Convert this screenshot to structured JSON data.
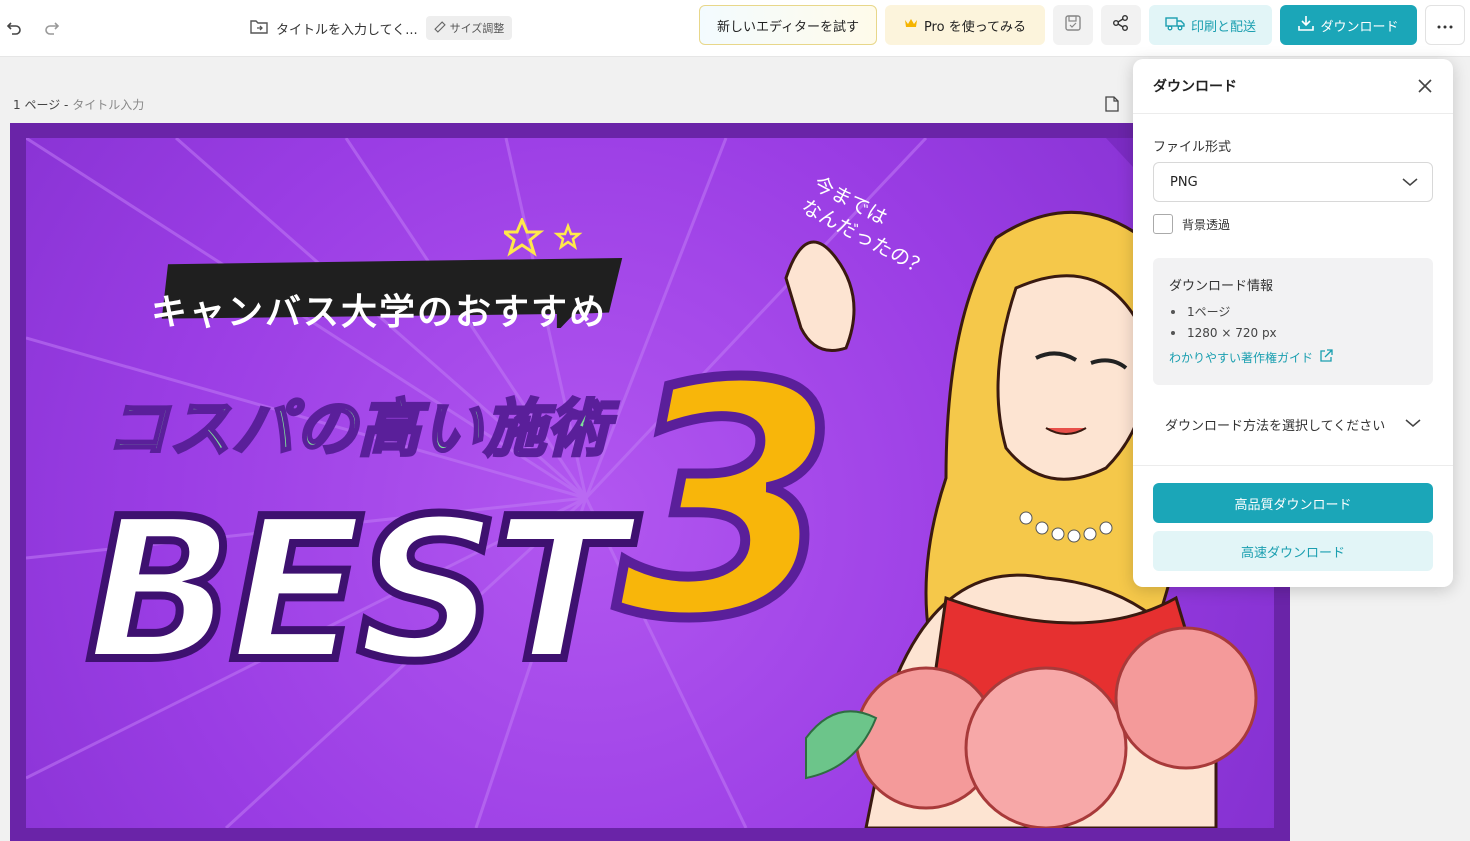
{
  "toolbar": {
    "title": "タイトルを入力してく...",
    "resize_label": "サイズ調整",
    "new_editor_label": "新しいエディターを試す",
    "pro_label": "Pro を使ってみる",
    "print_label": "印刷と配送",
    "download_label": "ダウンロード"
  },
  "page": {
    "label_number": "1 ページ",
    "label_title": "タイトル入力"
  },
  "design": {
    "banner_text": "キャンバス大学のおすすめ",
    "headline": "コスパの高い施術",
    "best": "BEST",
    "number": "3",
    "bubble": "今までは\nなんだったの？"
  },
  "download_panel": {
    "title": "ダウンロード",
    "format_label": "ファイル形式",
    "format_value": "PNG",
    "transparent_label": "背景透過",
    "info_title": "ダウンロード情報",
    "info_items": [
      "1ページ",
      "1280 × 720 px"
    ],
    "guide_link": "わかりやすい著作権ガイド",
    "method_label": "ダウンロード方法を選択してください",
    "hq_button": "高品質ダウンロード",
    "fast_button": "高速ダウンロード"
  },
  "colors": {
    "accent": "#1ba6b8",
    "canvas_purple": "#9a3de4",
    "headline_green": "#7fe09a",
    "number_yellow": "#f8b60a"
  }
}
